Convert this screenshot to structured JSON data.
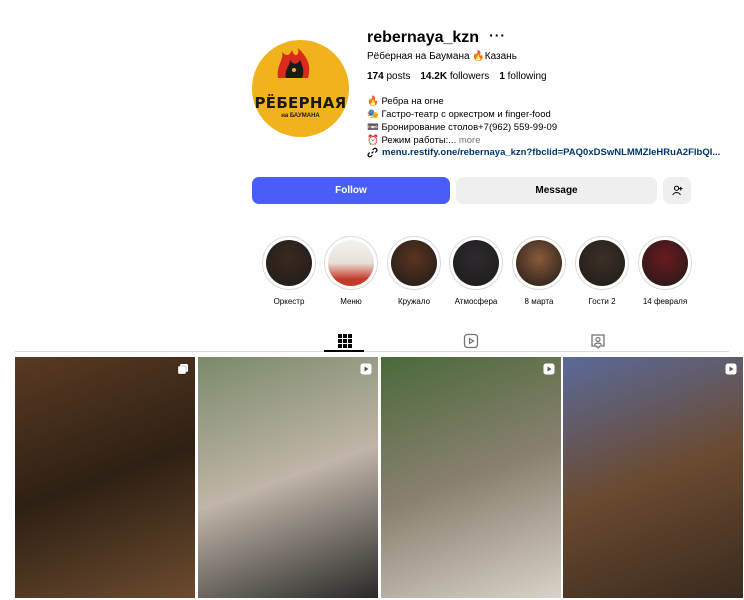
{
  "profile": {
    "username": "rebernaya_kzn",
    "more_label": "···",
    "subtitle": "Рёберная на Баумана 🔥Казань",
    "avatar": {
      "logo_text": "РЁБЕРНАЯ",
      "logo_sub": "на БАУМАНА"
    },
    "stats": {
      "posts_count": "174",
      "posts_label": "posts",
      "followers_count": "14.2K",
      "followers_label": "followers",
      "following_count": "1",
      "following_label": "following"
    },
    "bio": [
      "🔥 Ребра на огне",
      "🎭 Гастро-театр с оркестром и finger-food",
      "📼 Бронирование столов+7(962) 559-99-09",
      "⏰ Режим работы:..."
    ],
    "bio_more": "more",
    "link": "menu.restify.one/rebernaya_kzn?fbclid=PAQ0xDSwNLMMZleHRuA2FlbQI..."
  },
  "actions": {
    "follow": "Follow",
    "message": "Message"
  },
  "highlights": [
    {
      "label": "Оркестр",
      "color": "#3a2a20"
    },
    {
      "label": "Меню",
      "color": "#f2eeea"
    },
    {
      "label": "Кружало",
      "color": "#5a3420"
    },
    {
      "label": "Атмосфера",
      "color": "#2c2a30"
    },
    {
      "label": "8 марта",
      "color": "#8a5a3a"
    },
    {
      "label": "Гости 2",
      "color": "#3c3026"
    },
    {
      "label": "14 февраля",
      "color": "#6a1a20"
    }
  ],
  "tabs": [
    {
      "icon": "grid-icon",
      "active": true
    },
    {
      "icon": "reels-icon",
      "active": false
    },
    {
      "icon": "tagged-icon",
      "active": false
    }
  ],
  "posts": [
    {
      "type": "carousel",
      "colors": [
        "#5a3a22",
        "#2e2014",
        "#6b4b2e"
      ]
    },
    {
      "type": "reel",
      "colors": [
        "#7a8a6a",
        "#c0b5a8",
        "#2a2a28"
      ]
    },
    {
      "type": "reel",
      "colors": [
        "#4a6a3a",
        "#8a8070",
        "#d8d2c8"
      ]
    },
    {
      "type": "reel",
      "colors": [
        "#5a6a9a",
        "#6a4a30",
        "#3a2a1e"
      ]
    }
  ],
  "colors": {
    "accent": "#4a5df9",
    "secondary_button": "#efefef",
    "link": "#00376b",
    "muted": "#737373"
  }
}
